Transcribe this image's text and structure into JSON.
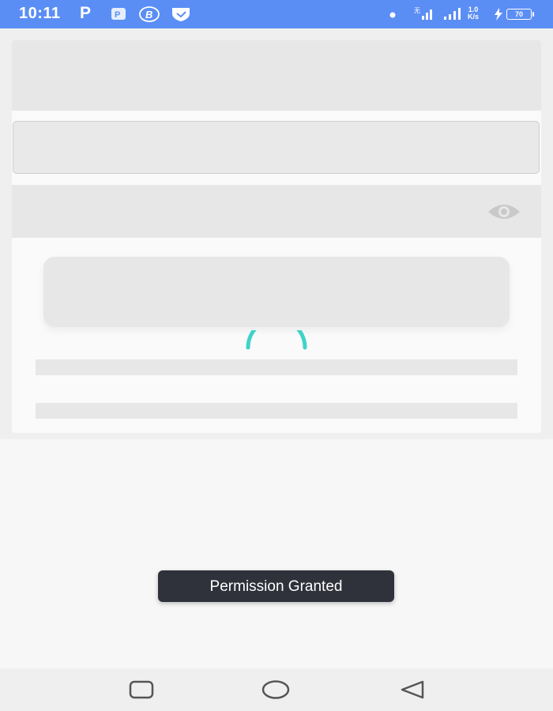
{
  "status_bar": {
    "time": "10:11",
    "app_letter": "P",
    "net_speed_value": "1.0",
    "net_speed_unit": "K/s",
    "battery": "70",
    "background_color": "#5b8ef5",
    "icons": [
      "parking-icon",
      "b-circle-icon",
      "shield-icon",
      "dot-icon",
      "signal-icon",
      "signal-icon",
      "charging-icon",
      "battery-icon"
    ]
  },
  "form": {
    "loading_spinner_color": "#3fd3c8",
    "icons": [
      "eye-icon"
    ]
  },
  "toast": {
    "message": "Permission Granted"
  },
  "nav_bar": {
    "icons": [
      "recent-apps-icon",
      "home-icon",
      "back-icon"
    ]
  }
}
